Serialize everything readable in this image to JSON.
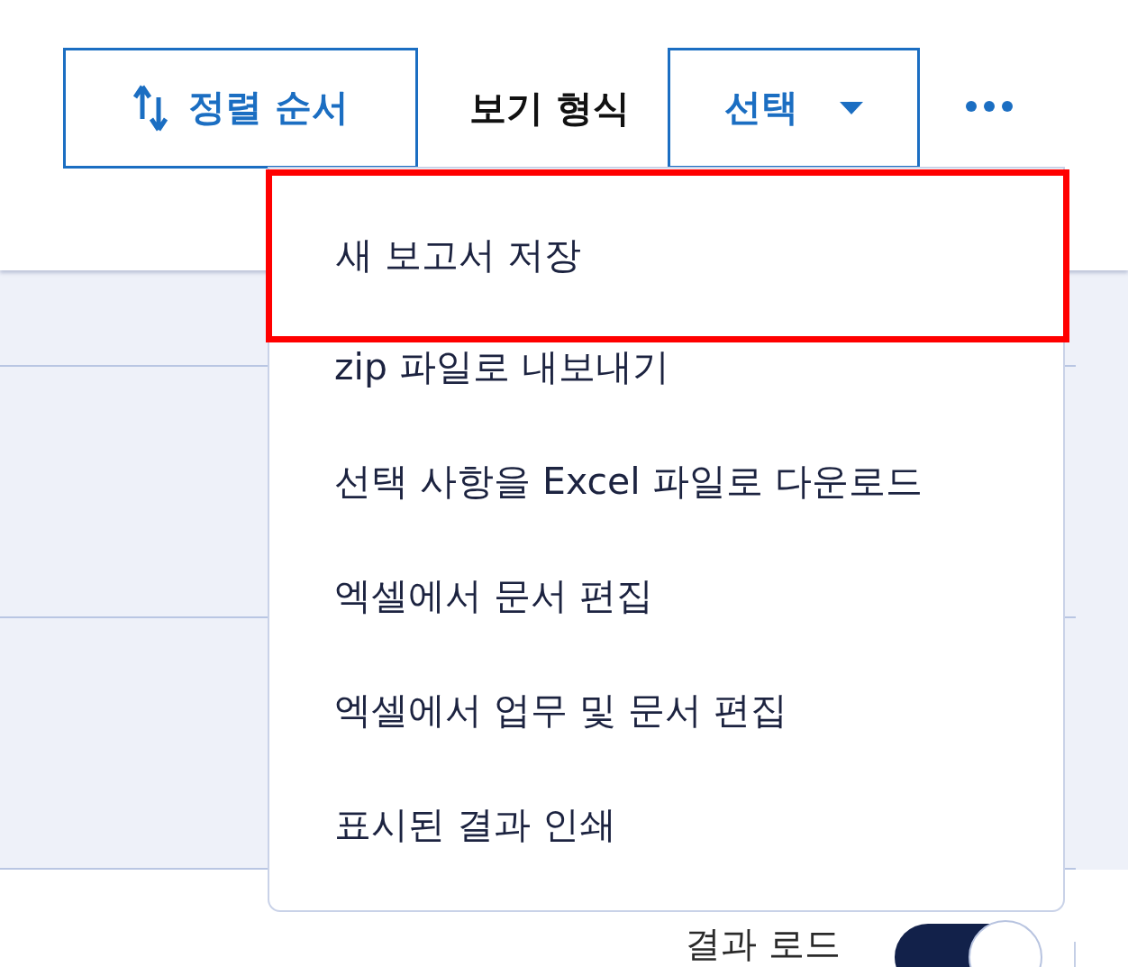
{
  "toolbar": {
    "sort_button": "정렬 순서",
    "view_label": "보기 형식",
    "select_button": "선택"
  },
  "menu": {
    "items": [
      {
        "label": "새 보고서 저장",
        "highlighted": true
      },
      {
        "label": "zip 파일로 내보내기",
        "highlighted": false
      },
      {
        "label": "선택 사항을 Excel 파일로 다운로드",
        "highlighted": false
      },
      {
        "label": "엑셀에서 문서 편집",
        "highlighted": false
      },
      {
        "label": "엑셀에서 업무 및 문서 편집",
        "highlighted": false
      },
      {
        "label": "표시된 결과 인쇄",
        "highlighted": false
      }
    ]
  },
  "load_results": {
    "label": "결과 로드",
    "on": true
  }
}
